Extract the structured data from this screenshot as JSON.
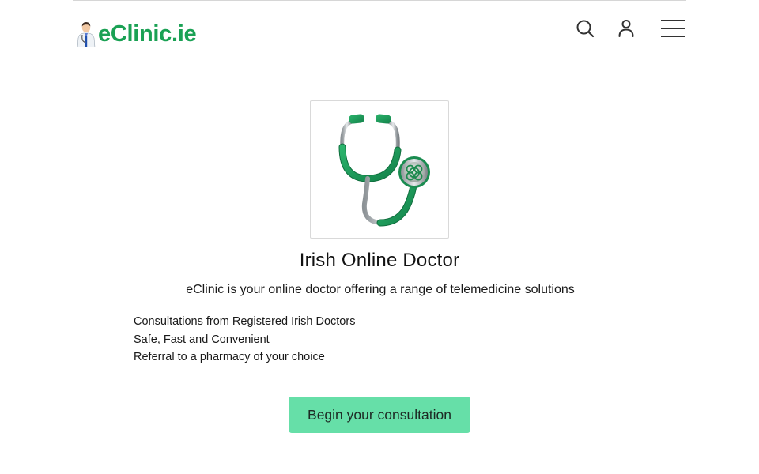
{
  "header": {
    "logo_text": "eClinic.ie",
    "icons": {
      "search": "search-icon",
      "account": "user-icon",
      "menu": "hamburger-menu-icon"
    }
  },
  "hero": {
    "image_icon": "stethoscope-celtic-knot-icon",
    "title": "Irish Online Doctor",
    "subtitle": "eClinic is your online doctor offering a range of telemedicine solutions"
  },
  "features": [
    "Consultations from Registered Irish Doctors",
    "Safe, Fast and Convenient",
    "Referral to a pharmacy of your choice"
  ],
  "cta": {
    "label": "Begin your consultation"
  },
  "colors": {
    "brand_green": "#1aa154",
    "button_bg": "#66dfa8",
    "stethoscope_green": "#1b9a5a"
  }
}
